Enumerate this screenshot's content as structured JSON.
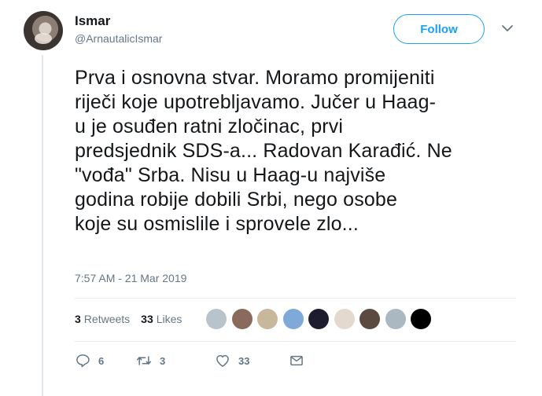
{
  "user": {
    "display_name": "Ismar",
    "handle": "@ArnautalicIsmar",
    "avatar_icon": "profile-photo"
  },
  "follow_button": {
    "label": "Follow"
  },
  "menu_icon": "chevron-down-icon",
  "tweet": {
    "lines": [
      "Prva i osnovna stvar. Moramo promijeniti",
      "riječi koje upotrebljavamo. Jučer u Haag-",
      "u je osuđen ratni zločinac, prvi",
      "predsjednik SDS-a... Radovan Karađić. Ne",
      "\"vođa\" Srba. Nisu u Haag-u najviše",
      "godina robije dobili Srbi, nego osobe",
      "koje su osmislile i sprovele zlo..."
    ],
    "timestamp": "7:57 AM - 21 Mar 2019"
  },
  "stats": {
    "retweets_count": "3",
    "retweets_label": "Retweets",
    "likes_count": "33",
    "likes_label": "Likes"
  },
  "liker_avatars": [
    "#b8c4cc",
    "#8a6a5c",
    "#c9b79c",
    "#7fa9d8",
    "#1c1c2e",
    "#e3d9cf",
    "#5a4a3f",
    "#aab8c2",
    "#000000"
  ],
  "actions": {
    "reply_count": "6",
    "retweet_count": "3",
    "like_count": "33"
  },
  "colors": {
    "accent": "#1da1f2",
    "secondary_text": "#657786",
    "primary_text": "#14171a"
  }
}
